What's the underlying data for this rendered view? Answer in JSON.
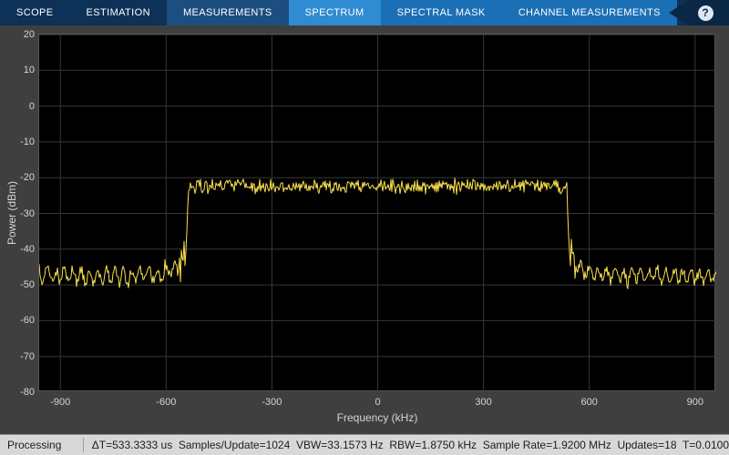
{
  "toolbar": {
    "tabs": [
      {
        "label": "SCOPE",
        "state": "normal"
      },
      {
        "label": "ESTIMATION",
        "state": "normal"
      },
      {
        "label": "MEASUREMENTS",
        "state": "selected"
      },
      {
        "label": "SPECTRUM",
        "state": "active-contextual"
      },
      {
        "label": "SPECTRAL MASK",
        "state": "contextual"
      },
      {
        "label": "CHANNEL MEASUREMENTS",
        "state": "contextual"
      }
    ],
    "help_label": "?"
  },
  "colors": {
    "toolbar_bg": "#0d3157",
    "active_tab": "#2f8bd2",
    "contextual_tab": "#1b6fb5",
    "plot_bg": "#000000",
    "trace": "#f9e14e",
    "status_bg": "#d8d8d8"
  },
  "chart_data": {
    "type": "line",
    "title": "",
    "xlabel": "Frequency (kHz)",
    "ylabel": "Power (dBm)",
    "xlim": [
      -960,
      960
    ],
    "ylim": [
      -80,
      20
    ],
    "x_ticks": [
      -900,
      -600,
      -300,
      0,
      300,
      600,
      900
    ],
    "y_ticks": [
      20,
      10,
      0,
      -10,
      -20,
      -30,
      -40,
      -50,
      -60,
      -70,
      -80
    ],
    "grid": true,
    "grid_color": "#383838",
    "trace_color": "#f9e14e",
    "legend": null,
    "signal": {
      "description": "Band-limited flat-top spectrum with noise floor and edge ringing",
      "passband_level_dbm": -22.4,
      "passband_edge_khz": 540,
      "transition_width_khz": 10,
      "noise_floor_dbm": -47.4,
      "noise_floor_ripple_db": 2.0,
      "edge_ring_peak_dbm": -38,
      "span_khz": 1920
    }
  },
  "status_bar": {
    "state": "Processing",
    "stats": [
      "ΔT=533.3333 us",
      "Samples/Update=1024",
      "VBW=33.1573 Hz",
      "RBW=1.8750 kHz",
      "Sample Rate=1.9200 MHz",
      "Updates=18",
      "T=0.0100"
    ],
    "stats_text": "ΔT=533.3333 us  Samples/Update=1024  VBW=33.1573 Hz  RBW=1.8750 kHz  Sample Rate=1.9200 MHz  Updates=18  T=0.0100"
  }
}
